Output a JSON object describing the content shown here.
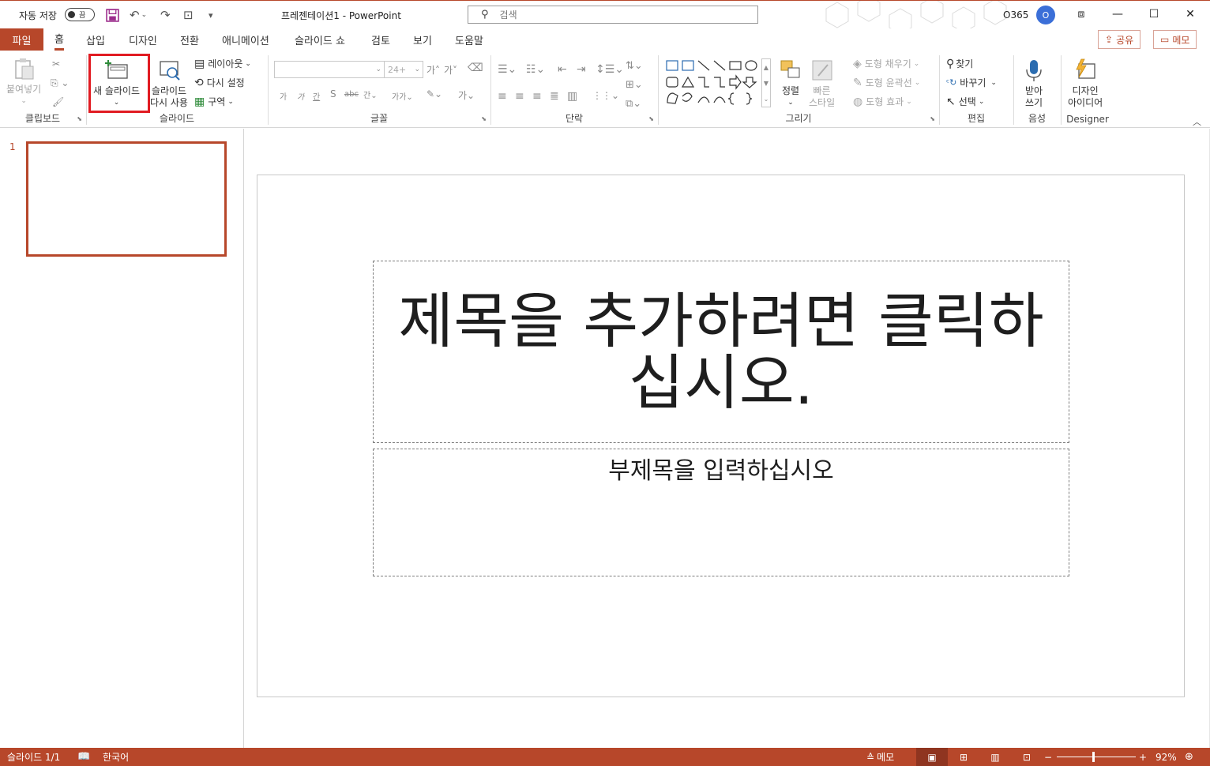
{
  "titlebar": {
    "autosave_label": "자동 저장",
    "autosave_state": "끔",
    "doc_title": "프레젠테이션1  -  PowerPoint",
    "search_placeholder": "검색",
    "user_name": "O365",
    "avatar_initial": "O"
  },
  "tabs": [
    "파일",
    "홈",
    "삽입",
    "디자인",
    "전환",
    "애니메이션",
    "슬라이드 쇼",
    "검토",
    "보기",
    "도움말"
  ],
  "share_label": "공유",
  "memo_label": "메모",
  "ribbon": {
    "clipboard": {
      "paste": "붙여넣기",
      "label": "클립보드"
    },
    "slides": {
      "new_slide": "새 슬라이드",
      "reuse_line1": "슬라이드",
      "reuse_line2": "다시 사용",
      "layout": "레이아웃",
      "reset": "다시 설정",
      "section": "구역",
      "label": "슬라이드"
    },
    "font": {
      "size": "24+",
      "label": "글꼴"
    },
    "paragraph": {
      "label": "단락"
    },
    "drawing": {
      "arrange": "정렬",
      "quick_styles_line1": "빠른",
      "quick_styles_line2": "스타일",
      "shape_fill": "도형 채우기",
      "shape_outline": "도형 윤곽선",
      "shape_effects": "도형 효과",
      "label": "그리기"
    },
    "editing": {
      "find": "찾기",
      "replace": "바꾸기",
      "select": "선택",
      "label": "편집"
    },
    "voice": {
      "dictate_line1": "받아",
      "dictate_line2": "쓰기",
      "label": "음성"
    },
    "designer": {
      "ideas_line1": "디자인",
      "ideas_line2": "아이디어",
      "label": "Designer"
    }
  },
  "thumbnail": {
    "slide_number": "1"
  },
  "slide": {
    "title_placeholder": "제목을 추가하려면 클릭하십시오.",
    "subtitle_placeholder": "부제목을 입력하십시오"
  },
  "statusbar": {
    "slide_info": "슬라이드 1/1",
    "language": "한국어",
    "notes": "메모",
    "zoom": "92%"
  },
  "colors": {
    "accent": "#b7472a",
    "highlight": "#e11b22"
  }
}
